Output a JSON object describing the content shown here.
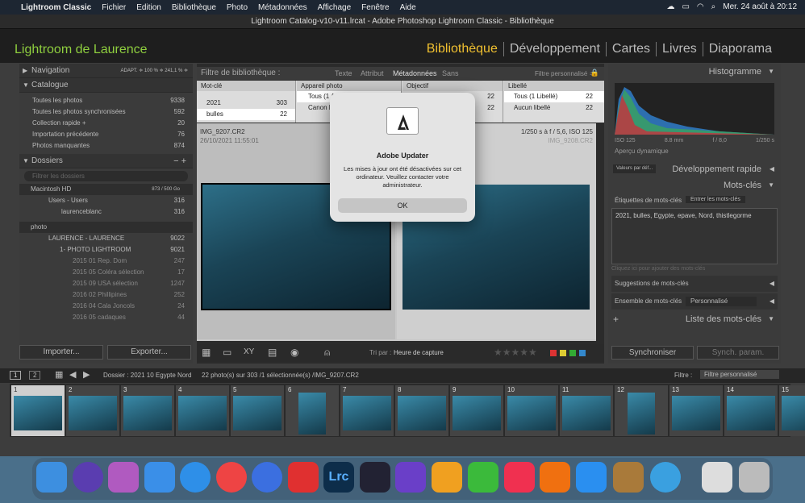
{
  "menubar": {
    "app": "Lightroom Classic",
    "items": [
      "Fichier",
      "Edition",
      "Bibliothèque",
      "Photo",
      "Métadonnées",
      "Affichage",
      "Fenêtre",
      "Aide"
    ],
    "clock": "Mer. 24 août à 20:12"
  },
  "window_title": "Lightroom Catalog-v10-v11.lrcat - Adobe Photoshop Lightroom Classic - Bibliothèque",
  "identity": "Lightroom de Laurence",
  "modules": [
    "Bibliothèque",
    "Développement",
    "Cartes",
    "Livres",
    "Diaporama"
  ],
  "left": {
    "navigation": {
      "label": "Navigation",
      "options": "ADAPT. ≑  100 %  ≑  241,1 % ≑"
    },
    "catalogue": {
      "label": "Catalogue",
      "items": [
        {
          "label": "Toutes les photos",
          "count": "9338"
        },
        {
          "label": "Toutes les photos synchronisées",
          "count": "592"
        },
        {
          "label": "Collection rapide +",
          "count": "20"
        },
        {
          "label": "Importation précédente",
          "count": "76"
        },
        {
          "label": "Photos manquantes",
          "count": "874"
        }
      ]
    },
    "dossiers": {
      "label": "Dossiers",
      "filter_placeholder": "Filtrer les dossiers",
      "volume1": {
        "name": "Macintosh HD",
        "size": "873 / 500 Go"
      },
      "items1": [
        {
          "label": "Users - Users",
          "count": "316"
        },
        {
          "label": "laurenceblanc",
          "count": "316"
        }
      ],
      "volume2": {
        "name": "photo"
      },
      "items2": [
        {
          "label": "LAURENCE - LAURENCE",
          "count": "9022"
        },
        {
          "label": "1- PHOTO LIGHTROOM",
          "count": "9021"
        },
        {
          "label": "2015 01 Rep. Dom",
          "count": "247"
        },
        {
          "label": "2015 05 Coléra sélection",
          "count": "17"
        },
        {
          "label": "2015 09 USA sélection",
          "count": "1247"
        },
        {
          "label": "2016 02 Phillipines",
          "count": "252"
        },
        {
          "label": "2016 04 Cala Joncols",
          "count": "24"
        },
        {
          "label": "2016 05 cadaques",
          "count": "44"
        }
      ]
    },
    "import_btn": "Importer...",
    "export_btn": "Exporter..."
  },
  "filterbar": {
    "title": "Filtre de bibliothèque :",
    "tabs": [
      "Texte",
      "Attribut",
      "Métadonnées",
      "Sans"
    ],
    "custom": "Filtre personnalisé ≑"
  },
  "metatable": {
    "cols": [
      {
        "header": "Mot-clé",
        "rows": [
          {
            "v": "2021",
            "c": "303"
          },
          {
            "v": "bulles",
            "c": "22"
          }
        ]
      },
      {
        "header": "Appareil photo",
        "rows": [
          {
            "v": "Tous (1 A...",
            "c": ""
          },
          {
            "v": "Canon R...",
            "c": ""
          }
        ]
      },
      {
        "header": "Objectif",
        "rows": [
          {
            "v": "",
            "c": "22"
          },
          {
            "v": "",
            "c": "22"
          }
        ]
      },
      {
        "header": "Libellé",
        "rows": [
          {
            "v": "Tous (1 Libellé)",
            "c": "22"
          },
          {
            "v": "Aucun libellé",
            "c": "22"
          }
        ]
      }
    ]
  },
  "cells": [
    {
      "name": "IMG_9207.CR2",
      "date": "26/10/2021 11:55:01",
      "exif": ""
    },
    {
      "name": "IMG_9208.CR2",
      "date": "",
      "exif": "1/250 s à f / 5,6, ISO 125"
    }
  ],
  "toolbar": {
    "sort_label": "Tri par :",
    "sort_value": "Capture time",
    "sort_value_fr": "Heure de capture"
  },
  "right": {
    "histogram": "Histogramme",
    "hist_info": [
      "ISO 125",
      "8.8 mm",
      "f / 8,0",
      "1/250 s"
    ],
    "apercu": "Aperçu dynamique",
    "quick_dev": "Développement rapide",
    "quick_preset": "Valeurs par déf...",
    "keywords": "Mots-clés",
    "kw_tags_label": "Étiquettes de mots-clés",
    "kw_tags_mode": "Entrer les mots-clés",
    "kw_tags": "2021, bulles, Egypte, epave, Nord, thistlegorme",
    "kw_add": "Cliquez ici pour ajouter des mots-clés",
    "kw_suggest": "Suggestions de mots-clés",
    "kw_set_label": "Ensemble de mots-clés",
    "kw_set_value": "Personnalisé",
    "kw_list": "Liste des mots-clés",
    "sync": "Synchroniser",
    "sync_params": "Synch. param."
  },
  "filmhead": {
    "pages": [
      "1",
      "2"
    ],
    "folder": "Dossier : 2021 10 Egypte Nord",
    "count": "22 photo(s) sur 303 /1 sélectionnée(s) /IMG_9207.CR2",
    "filter_label": "Filtre :",
    "filter_value": "Filtre personnalisé"
  },
  "film_numbers": [
    "1",
    "2",
    "3",
    "4",
    "5",
    "6",
    "7",
    "8",
    "9",
    "10",
    "11",
    "12",
    "13",
    "14",
    "15"
  ],
  "dialog": {
    "title": "Adobe Updater",
    "message": "Les mises à jour ont été désactivées sur cet ordinateur. Veuillez contacter votre administrateur.",
    "ok": "OK"
  }
}
